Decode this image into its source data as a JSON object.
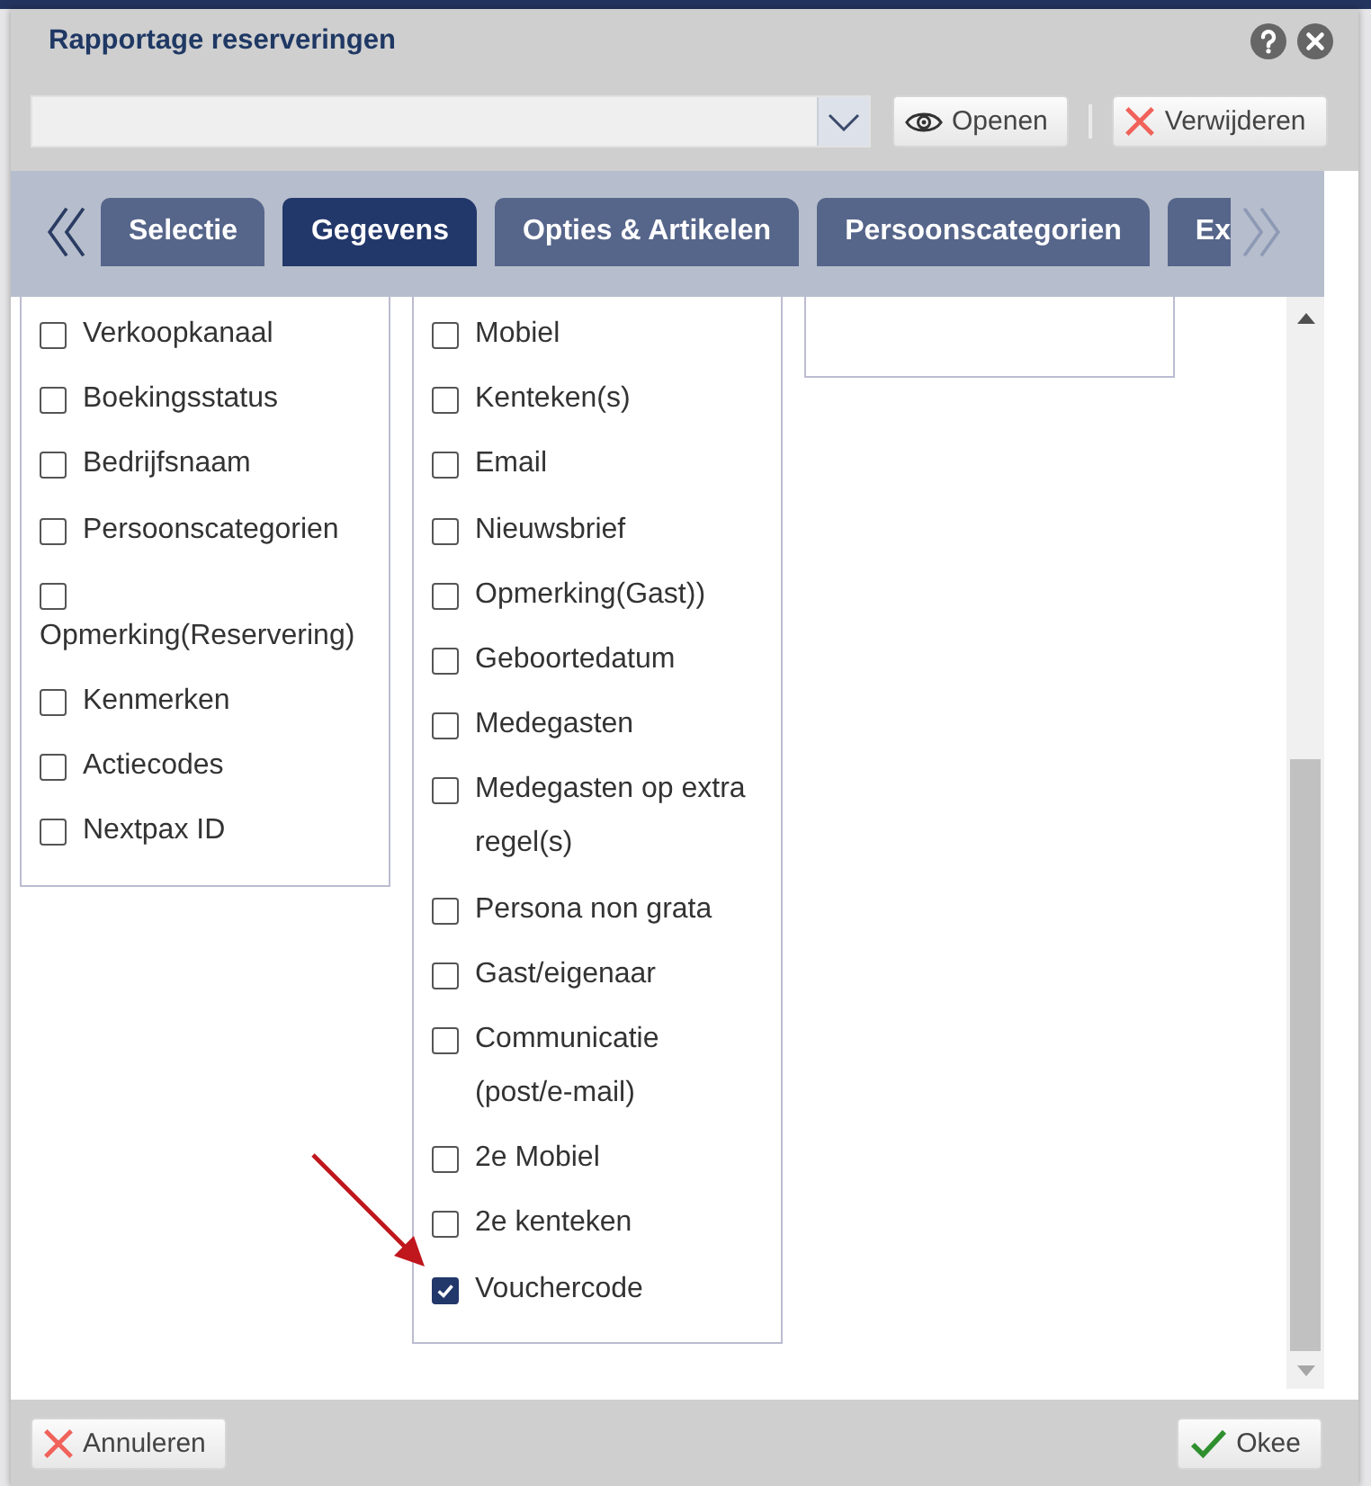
{
  "dialog": {
    "title": "Rapportage reserveringen"
  },
  "toolbar": {
    "buttons": [
      {
        "kind": "open",
        "label": "Openen"
      },
      {
        "kind": "delete",
        "label": "Verwijderen"
      }
    ]
  },
  "tabs": [
    {
      "label": "Selectie",
      "selected": false
    },
    {
      "label": "Gegevens",
      "selected": true
    },
    {
      "label": "Opties & Artikelen",
      "selected": false
    },
    {
      "label": "Persoonscategorien",
      "selected": false
    },
    {
      "label": "Ex",
      "selected": false
    }
  ],
  "columns": [
    {
      "items": [
        {
          "label": "Verkoopkanaal",
          "checked": false
        },
        {
          "label": "Boekingsstatus",
          "checked": false
        },
        {
          "label": "Bedrijfsnaam",
          "checked": false
        },
        {
          "label": "Persoonscategorien",
          "checked": false
        },
        {
          "label": "Opmerking(Reservering)",
          "checked": false
        },
        {
          "label": "Kenmerken",
          "checked": false
        },
        {
          "label": "Actiecodes",
          "checked": false
        },
        {
          "label": "Nextpax ID",
          "checked": false
        }
      ]
    },
    {
      "items": [
        {
          "label": "Mobiel",
          "checked": false
        },
        {
          "label": "Kenteken(s)",
          "checked": false
        },
        {
          "label": "Email",
          "checked": false
        },
        {
          "label": "Nieuwsbrief",
          "checked": false
        },
        {
          "label": "Opmerking(Gast))",
          "checked": false
        },
        {
          "label": "Geboortedatum",
          "checked": false
        },
        {
          "label": "Medegasten",
          "checked": false
        },
        {
          "label": "Medegasten op extra regel(s)",
          "checked": false
        },
        {
          "label": "Persona non grata",
          "checked": false
        },
        {
          "label": "Gast/eigenaar",
          "checked": false
        },
        {
          "label": "Communicatie (post/e-mail)",
          "checked": false
        },
        {
          "label": "2e Mobiel",
          "checked": false
        },
        {
          "label": "2e kenteken",
          "checked": false
        },
        {
          "label": "Vouchercode",
          "checked": true
        }
      ]
    }
  ],
  "footer": {
    "buttons": [
      {
        "kind": "cancel",
        "label": "Annuleren"
      },
      {
        "kind": "ok",
        "label": "Okee"
      }
    ]
  }
}
